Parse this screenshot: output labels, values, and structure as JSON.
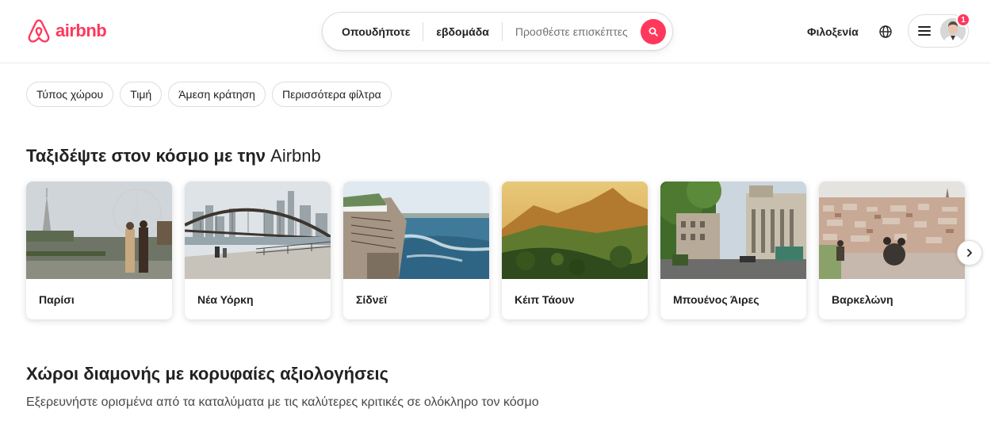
{
  "brand": {
    "name": "airbnb",
    "color": "#FF385C",
    "icon": "airbnb-logo-icon"
  },
  "search": {
    "where": "Οπουδήποτε",
    "when": "εβδομάδα",
    "guests_placeholder": "Προσθέστε επισκέπτες",
    "button_icon": "search-icon"
  },
  "header": {
    "host_label": "Φιλοξενία",
    "language_icon": "globe-icon",
    "menu_icon": "hamburger-menu-icon",
    "notification_count": "1"
  },
  "filters": [
    {
      "label": "Τύπος χώρου"
    },
    {
      "label": "Τιμή"
    },
    {
      "label": "Άμεση κράτηση"
    },
    {
      "label": "Περισσότερα φίλτρα"
    }
  ],
  "travel_section": {
    "title_bold": "Ταξιδέψτε στον κόσμο με την",
    "title_normal": " Airbnb",
    "destinations": [
      {
        "name": "Παρίσι"
      },
      {
        "name": "Νέα Υόρκη"
      },
      {
        "name": "Σίδνεϊ"
      },
      {
        "name": "Κέιπ Τάουν"
      },
      {
        "name": "Μπουένος Άιρες"
      },
      {
        "name": "Βαρκελώνη"
      }
    ],
    "next_icon": "chevron-right-icon"
  },
  "top_rated_section": {
    "title": "Χώροι διαμονής με κορυφαίες αξιολογήσεις",
    "subtitle": "Εξερευνήστε ορισμένα από τα καταλύματα με τις καλύτερες κριτικές σε ολόκληρο τον κόσμο"
  }
}
